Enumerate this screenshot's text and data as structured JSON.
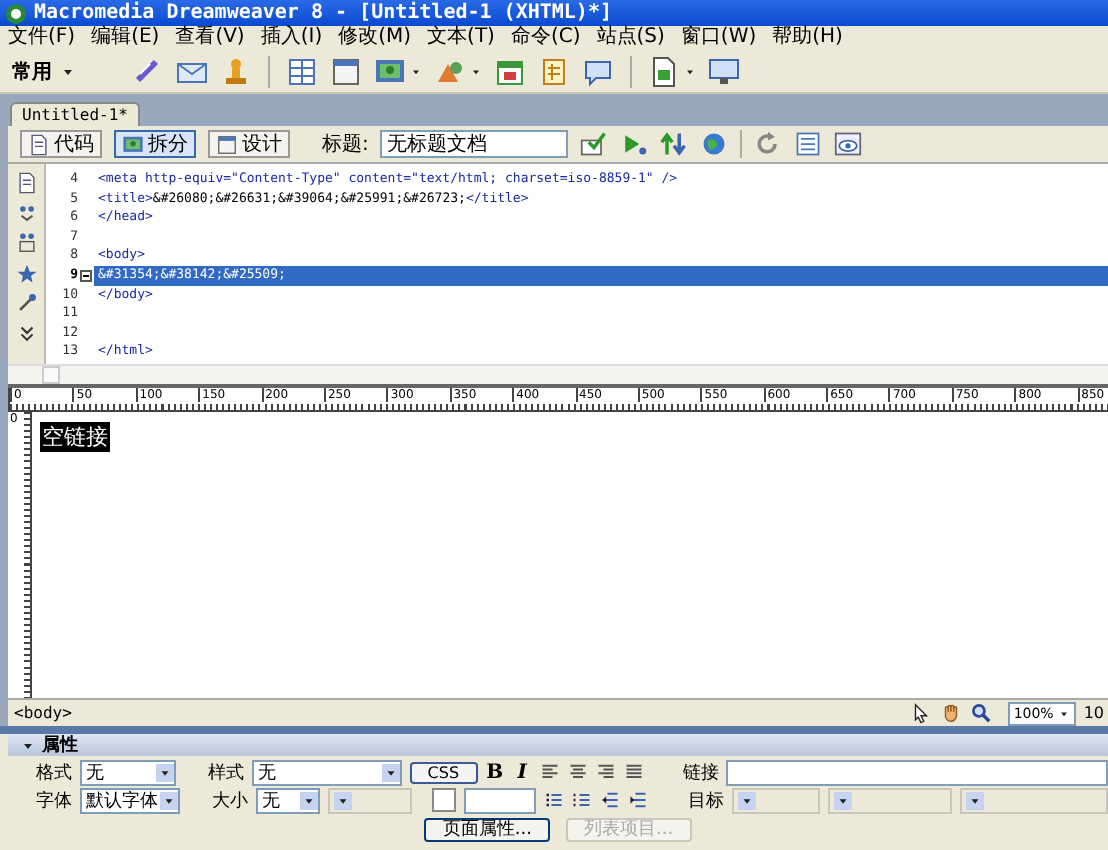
{
  "window": {
    "title": "Macromedia Dreamweaver 8 - [Untitled-1 (XHTML)*]"
  },
  "menu": [
    "文件(F)",
    "编辑(E)",
    "查看(V)",
    "插入(I)",
    "修改(M)",
    "文本(T)",
    "命令(C)",
    "站点(S)",
    "窗口(W)",
    "帮助(H)"
  ],
  "insert_bar": {
    "category": "常用"
  },
  "document_tabs": [
    {
      "label": "Untitled-1*",
      "selected": true
    }
  ],
  "view_buttons": [
    {
      "label": "代码",
      "selected": false
    },
    {
      "label": "拆分",
      "selected": true
    },
    {
      "label": "设计",
      "selected": false
    }
  ],
  "title_field": {
    "label": "标题:",
    "value": "无标题文档"
  },
  "code_lines": [
    {
      "number": "4",
      "text": "<meta http-equiv=\"Content-Type\" content=\"text/html; charset=iso-8859-1\" />",
      "selected": false,
      "foldable": false
    },
    {
      "number": "5",
      "text": "<title>&#26080;&#26631;&#39064;&#25991;&#26723;</title>",
      "selected": false,
      "foldable": false
    },
    {
      "number": "6",
      "text": "</head>",
      "selected": false,
      "foldable": false
    },
    {
      "number": "7",
      "selected": false,
      "foldable": false
    },
    {
      "number": "8",
      "text": "<body>",
      "selected": false,
      "foldable": false
    },
    {
      "number": "9",
      "text": "&#31354;&#38142;&#25509;",
      "selected": true,
      "foldable": true
    },
    {
      "number": "10",
      "text": "</body>",
      "selected": false,
      "foldable": false
    },
    {
      "number": "11",
      "selected": false,
      "foldable": false
    },
    {
      "number": "12",
      "selected": false,
      "foldable": false
    },
    {
      "number": "13",
      "text": "</html>",
      "selected": false,
      "foldable": false
    }
  ],
  "ruler": {
    "labels": [
      "0",
      "50",
      "100",
      "150",
      "200",
      "250",
      "300",
      "350",
      "400",
      "450",
      "500",
      "550",
      "600",
      "650",
      "700",
      "750",
      "800",
      "850"
    ],
    "vertical_labels": [
      "0"
    ]
  },
  "design": {
    "selected_text": "空链接"
  },
  "status_bar": {
    "tag": "<body>",
    "zoom": "100%",
    "size": "10"
  },
  "properties": {
    "title": "属性",
    "format": {
      "label": "格式",
      "value": "无"
    },
    "style": {
      "label": "样式",
      "value": "无"
    },
    "css_button": "CSS",
    "bold": "B",
    "italic": "I",
    "link": {
      "label": "链接"
    },
    "font": {
      "label": "字体",
      "value": "默认字体"
    },
    "size": {
      "label": "大小",
      "value": "无"
    },
    "target": {
      "label": "目标"
    },
    "buttons": [
      {
        "label": "页面属性...",
        "disabled": false
      },
      {
        "label": "列表项目...",
        "disabled": true
      }
    ]
  }
}
